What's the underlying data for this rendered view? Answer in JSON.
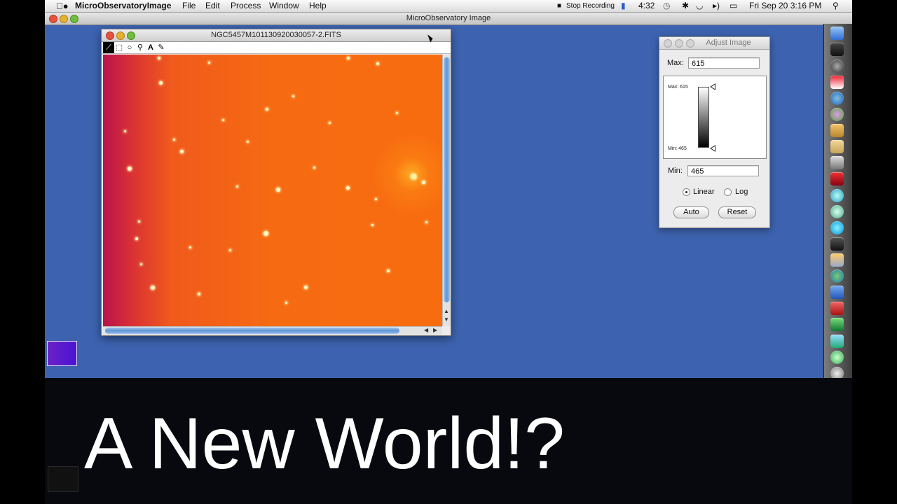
{
  "menubar": {
    "app_name": "MicroObservatoryImage",
    "menus": [
      "File",
      "Edit",
      "Process",
      "Window",
      "Help"
    ],
    "recording": "Stop Recording",
    "timer": "4:32",
    "clock": "Fri Sep 20  3:16 PM"
  },
  "app_window_title": "MicroObservatory Image",
  "image_window": {
    "title": "NGC5457M101130920030057-2.FITS",
    "tools": [
      "line-tool",
      "rectangle-select-tool",
      "oval-tool",
      "magnifier-tool",
      "text-tool",
      "pencil-tool"
    ],
    "text_tool_glyph": "A"
  },
  "adjust_panel": {
    "title": "Adjust Image",
    "max_label": "Max:",
    "max_value": "615",
    "ramp_max_label": "Max: 615",
    "ramp_min_label": "Min: 465",
    "min_label": "Min:",
    "min_value": "465",
    "scale_options": [
      "Linear",
      "Log"
    ],
    "scale_selected": "Linear",
    "auto_button": "Auto",
    "reset_button": "Reset"
  },
  "caption": "A New World!?",
  "colors": {
    "desktop": "#3d63b0",
    "image_red": "#b8124b",
    "image_orange": "#f86c10"
  }
}
